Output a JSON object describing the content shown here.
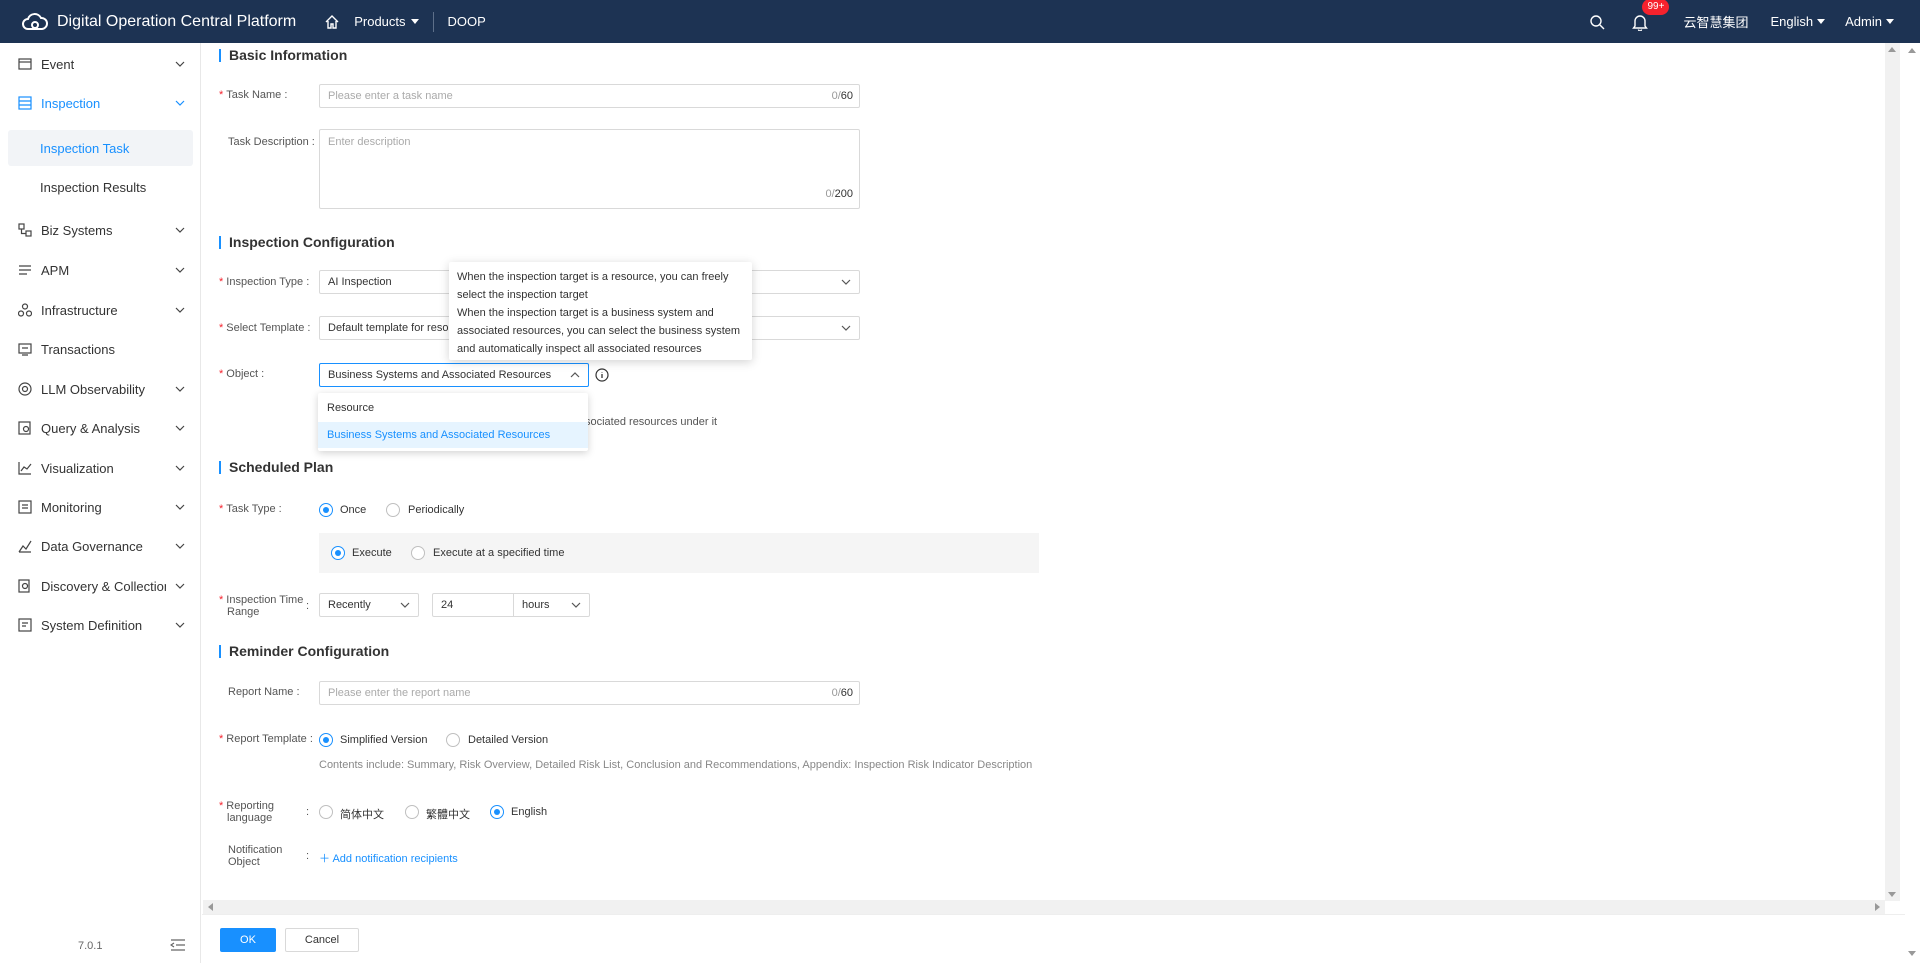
{
  "header": {
    "app_title": "Digital Operation Central Platform",
    "products": "Products",
    "module": "DOOP",
    "notifications_badge": "99+",
    "org": "云智慧集团",
    "language": "English",
    "user": "Admin"
  },
  "sidebar": {
    "items": [
      {
        "label": "Event",
        "icon": "event-icon"
      },
      {
        "label": "Inspection",
        "icon": "inspection-icon"
      },
      {
        "label": "Biz Systems",
        "icon": "biz-systems-icon"
      },
      {
        "label": "APM",
        "icon": "apm-icon"
      },
      {
        "label": "Infrastructure",
        "icon": "infrastructure-icon"
      },
      {
        "label": "Transactions",
        "icon": "transactions-icon"
      },
      {
        "label": "LLM Observability",
        "icon": "llm-icon"
      },
      {
        "label": "Query & Analysis",
        "icon": "query-icon"
      },
      {
        "label": "Visualization",
        "icon": "visualization-icon"
      },
      {
        "label": "Monitoring",
        "icon": "monitoring-icon"
      },
      {
        "label": "Data Governance",
        "icon": "data-governance-icon"
      },
      {
        "label": "Discovery & Collection",
        "icon": "discovery-icon"
      },
      {
        "label": "System Definition",
        "icon": "system-definition-icon"
      }
    ],
    "sub_items": [
      "Inspection Task",
      "Inspection Results"
    ],
    "version": "7.0.1",
    "active_color": "#1890ff"
  },
  "form": {
    "basic": {
      "title": "Basic Information",
      "task_name_label": "Task Name",
      "task_name_placeholder": "Please enter a task name",
      "task_name_count": "0",
      "task_name_max": "60",
      "desc_label": "Task Description",
      "desc_placeholder": "Enter description",
      "desc_count": "0",
      "desc_max": "200"
    },
    "config": {
      "title": "Inspection Configuration",
      "type_label": "Inspection Type",
      "type_value": "AI Inspection",
      "template_label": "Select Template",
      "template_value": "Default template for resou",
      "object_label": "Object",
      "object_value": "Business Systems and Associated Resources",
      "object_options": [
        "Resource",
        "Business Systems and Associated Resources"
      ],
      "hint_fragment": "sociated resources under it",
      "tooltip_line1": "When the inspection target is a resource, you can freely select the inspection target",
      "tooltip_line2": "When the inspection target is a business system and associated resources, you can select the business system and automatically inspect all associated resources"
    },
    "plan": {
      "title": "Scheduled Plan",
      "task_type_label": "Task Type",
      "once": "Once",
      "periodically": "Periodically",
      "execute": "Execute",
      "execute_at": "Execute at a specified time",
      "time_range_label": "Inspection Time Range",
      "range_mode": "Recently",
      "range_value": "24",
      "range_unit": "hours"
    },
    "reminder": {
      "title": "Reminder Configuration",
      "report_name_label": "Report Name",
      "report_name_placeholder": "Please enter the report name",
      "report_name_count": "0",
      "report_name_max": "60",
      "template_label": "Report Template",
      "simplified": "Simplified Version",
      "detailed": "Detailed Version",
      "contents_note": "Contents include: Summary, Risk Overview, Detailed Risk List, Conclusion and Recommendations, Appendix: Inspection Risk Indicator Description",
      "language_label": "Reporting language",
      "lang_sc": "简体中文",
      "lang_tc": "繁體中文",
      "lang_en": "English",
      "notify_label": "Notification Object",
      "add_recipients": "Add notification recipients"
    }
  },
  "footer": {
    "ok": "OK",
    "cancel": "Cancel"
  }
}
